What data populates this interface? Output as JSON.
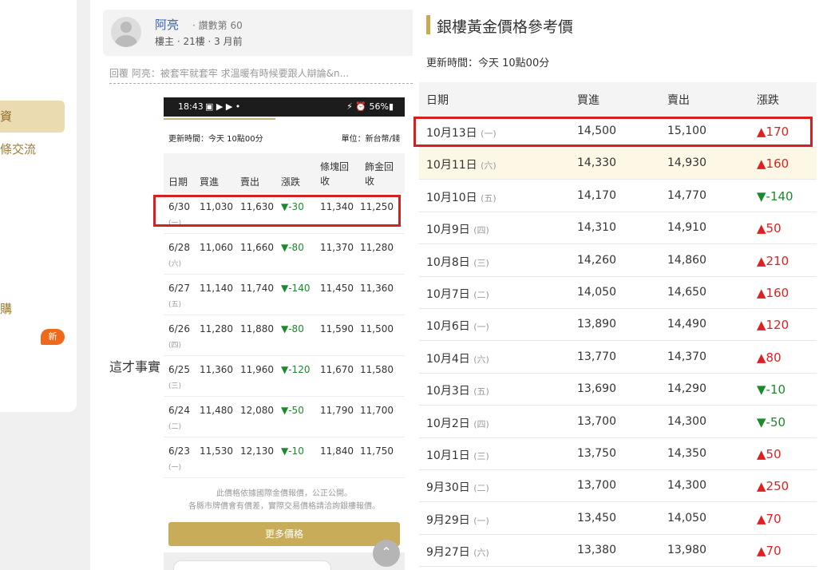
{
  "sidebar": {
    "items": [
      {
        "label": "資",
        "active": true
      },
      {
        "label": "條交流"
      },
      {
        "label": "購"
      }
    ],
    "new_badge": "新"
  },
  "post": {
    "author": "阿亮",
    "author_meta": "· 讚數第 60",
    "info": "樓主 · 21樓 · 3 月前",
    "quote": "回覆 阿亮：被套牢就套牢 求溫暖有時候要跟人辯論&n...",
    "body_text": "這才事實"
  },
  "phone": {
    "status_time": "18:43",
    "status_icons": "▣ ▶ ▶ •",
    "status_battery": "⚡ ⏰ 56%▮",
    "update": "更新時間：今天 10點00分",
    "unit": "單位：新台幣/錢",
    "headers": [
      "日期",
      "買進",
      "賣出",
      "漲跌",
      "條塊回收",
      "飾金回收"
    ],
    "rows": [
      {
        "date": "6/30",
        "weekday": "(一)",
        "buy": "11,030",
        "sell": "11,630",
        "change": "▼-30",
        "bar": "11,340",
        "jewel": "11,250"
      },
      {
        "date": "6/28",
        "weekday": "(六)",
        "buy": "11,060",
        "sell": "11,660",
        "change": "▼-80",
        "bar": "11,370",
        "jewel": "11,280"
      },
      {
        "date": "6/27",
        "weekday": "(五)",
        "buy": "11,140",
        "sell": "11,740",
        "change": "▼-140",
        "bar": "11,450",
        "jewel": "11,360"
      },
      {
        "date": "6/26",
        "weekday": "(四)",
        "buy": "11,280",
        "sell": "11,880",
        "change": "▼-80",
        "bar": "11,590",
        "jewel": "11,500"
      },
      {
        "date": "6/25",
        "weekday": "(三)",
        "buy": "11,360",
        "sell": "11,960",
        "change": "▼-120",
        "bar": "11,670",
        "jewel": "11,580"
      },
      {
        "date": "6/24",
        "weekday": "(二)",
        "buy": "11,480",
        "sell": "12,080",
        "change": "▼-50",
        "bar": "11,790",
        "jewel": "11,700"
      },
      {
        "date": "6/23",
        "weekday": "(一)",
        "buy": "11,530",
        "sell": "12,130",
        "change": "▼-10",
        "bar": "11,840",
        "jewel": "11,750"
      }
    ],
    "note1": "此價格依據國際金價報價，公正公開。",
    "note2": "各縣市牌價會有價差，實際交易價格請洽詢銀樓報價。",
    "more_button": "更多價格"
  },
  "scroll_top_icon": "chevron-up-icon",
  "price_table": {
    "title": "銀樓黃金價格參考價",
    "update": "更新時間：今天 10點00分",
    "headers": [
      "日期",
      "買進",
      "賣出",
      "漲跌"
    ],
    "rows": [
      {
        "date": "10月13日",
        "weekday": "(一)",
        "buy": "14,500",
        "sell": "15,100",
        "change": "▲170",
        "dir": "up"
      },
      {
        "date": "10月11日",
        "weekday": "(六)",
        "buy": "14,330",
        "sell": "14,930",
        "change": "▲160",
        "dir": "up"
      },
      {
        "date": "10月10日",
        "weekday": "(五)",
        "buy": "14,170",
        "sell": "14,770",
        "change": "▼-140",
        "dir": "down"
      },
      {
        "date": "10月9日",
        "weekday": "(四)",
        "buy": "14,310",
        "sell": "14,910",
        "change": "▲50",
        "dir": "up"
      },
      {
        "date": "10月8日",
        "weekday": "(三)",
        "buy": "14,260",
        "sell": "14,860",
        "change": "▲210",
        "dir": "up"
      },
      {
        "date": "10月7日",
        "weekday": "(二)",
        "buy": "14,050",
        "sell": "14,650",
        "change": "▲160",
        "dir": "up"
      },
      {
        "date": "10月6日",
        "weekday": "(一)",
        "buy": "13,890",
        "sell": "14,490",
        "change": "▲120",
        "dir": "up"
      },
      {
        "date": "10月4日",
        "weekday": "(六)",
        "buy": "13,770",
        "sell": "14,370",
        "change": "▲80",
        "dir": "up"
      },
      {
        "date": "10月3日",
        "weekday": "(五)",
        "buy": "13,690",
        "sell": "14,290",
        "change": "▼-10",
        "dir": "down"
      },
      {
        "date": "10月2日",
        "weekday": "(四)",
        "buy": "13,700",
        "sell": "14,300",
        "change": "▼-50",
        "dir": "down"
      },
      {
        "date": "10月1日",
        "weekday": "(三)",
        "buy": "13,750",
        "sell": "14,350",
        "change": "▲50",
        "dir": "up"
      },
      {
        "date": "9月30日",
        "weekday": "(二)",
        "buy": "13,700",
        "sell": "14,300",
        "change": "▲250",
        "dir": "up"
      },
      {
        "date": "9月29日",
        "weekday": "(一)",
        "buy": "13,450",
        "sell": "14,050",
        "change": "▲70",
        "dir": "up"
      },
      {
        "date": "9月27日",
        "weekday": "(六)",
        "buy": "13,380",
        "sell": "13,980",
        "change": "▲70",
        "dir": "up"
      }
    ]
  },
  "colors": {
    "up": "#e02020",
    "down": "#1b8a2a",
    "highlight_box": "#d42020",
    "accent": "#c8a954"
  }
}
